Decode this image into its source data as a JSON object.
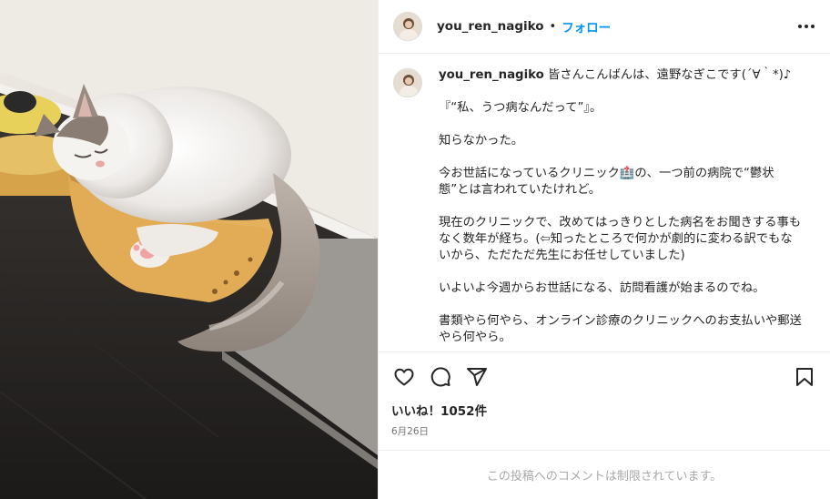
{
  "post": {
    "username": "you_ren_nagiko",
    "separator": "•",
    "follow_label": "フォロー",
    "more_icon": "more-horizontal-icon"
  },
  "caption": {
    "username": "you_ren_nagiko",
    "first_line": " 皆さんこんばんは、遠野なぎこです(´∀｀*)♪",
    "paragraphs": [
      "『“私、うつ病なんだって”』。",
      "知らなかった。",
      "今お世話になっているクリニック🏥の、一つ前の病院で“鬱状態”とは言われていたけれど。",
      "現在のクリニックで、改めてはっきりとした病名をお聞きする事もなく数年が経ち。(⇦知ったところで何かが劇的に変わる訳でもないから、ただただ先生にお任せしていました)",
      "いよいよ今週からお世話になる、訪問看護が始まるのでね。",
      "書類やら何やら、オンライン診療のクリニックへのお支払いや郵送やら何やら。"
    ]
  },
  "actions": {
    "icons": [
      "heart-icon",
      "comment-icon",
      "share-icon",
      "bookmark-icon"
    ]
  },
  "likes_text": "いいね！1052件",
  "date_text": "6月26日",
  "comments_restricted": "この投稿へのコメントは制限されています。",
  "colors": {
    "accent": "#0095f6",
    "text": "#262626",
    "muted": "#737373",
    "border": "#efefef"
  }
}
